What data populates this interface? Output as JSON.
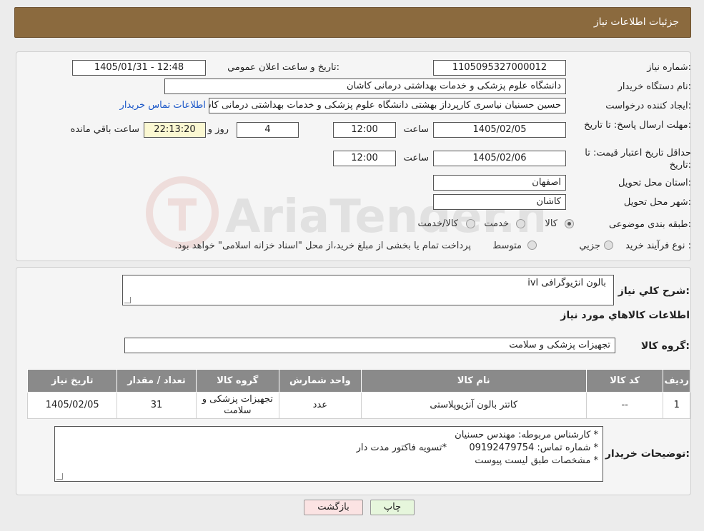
{
  "header": {
    "title": "جزئیات اطلاعات نیاز"
  },
  "form": {
    "need_number_label": "شماره نیاز:",
    "need_number": "1105095327000012",
    "announce_label": "تاریخ و ساعت اعلان عمومي:",
    "announce_value": "1405/01/31 - 12:48",
    "buyer_org_label": "نام دستگاه خریدار:",
    "buyer_org": "دانشگاه علوم پزشکی و خدمات بهداشتی درمانی کاشان",
    "creator_label": "ایجاد کننده درخواست:",
    "creator": "حسین حسنیان نیاسری کارپرداز بهشتی دانشگاه علوم پزشکی و خدمات بهداشتی درمانی کاشان",
    "contact_link": "اطلاعات تماس خریدار",
    "deadline_label": "مهلت ارسال پاسخ: تا تاریخ:",
    "deadline_date": "1405/02/05",
    "time_label": "ساعت",
    "deadline_time": "12:00",
    "days_value": "4",
    "days_label": "روز و",
    "remaining_time": "22:13:20",
    "remaining_label": "ساعت باقي مانده",
    "validity_label": "حداقل تاریخ اعتبار قیمت: تا تاریخ:",
    "validity_date": "1405/02/06",
    "validity_time": "12:00",
    "province_label": "استان محل تحویل:",
    "province": "اصفهان",
    "city_label": "شهر محل تحویل:",
    "city": "کاشان",
    "category_label": "طبقه بندی موضوعی:",
    "category_options": [
      "کالا",
      "خدمت",
      "کالا/خدمت"
    ],
    "process_label": "نوع فرآیند خرید :",
    "process_options": [
      "جزیي",
      "متوسط"
    ],
    "process_note": "پرداخت تمام یا بخشی از مبلغ خرید،از محل \"اسناد خزانه اسلامی\" خواهد بود."
  },
  "description": {
    "label": "شرح كلي نیاز:",
    "value": "بالون انژیوگرافی ivl"
  },
  "goods": {
    "section_title": "اطلاعات كالاهاي مورد نياز",
    "group_label": "گروه کالا:",
    "group_value": "تجهیزات پزشکی و سلامت",
    "columns": [
      "ردیف",
      "کد کالا",
      "نام کالا",
      "واحد شمارش",
      "گروه کالا",
      "تعداد / مقدار",
      "تاریخ نیاز"
    ],
    "rows": [
      [
        "1",
        "--",
        "کاتتر بالون آنژیوپلاستی",
        "عدد",
        "تجهیزات پزشکی و سلامت",
        "31",
        "1405/02/05"
      ]
    ]
  },
  "buyer_notes": {
    "label": "توضیحات خریدار:",
    "line1": "*  کارشناس مربوطه: مهندس حسنیان",
    "line2": "*  شماره تماس: 09192479754",
    "line2_extra": "*تسویه فاکتور مدت دار",
    "line3": "*  مشخصات طبق لیست پیوست"
  },
  "buttons": {
    "print": "چاپ",
    "back": "بازگشت"
  },
  "watermark": {
    "text": "AriaTender.neT"
  },
  "colors": {
    "header_bg": "#8b6a3e",
    "table_header_bg": "#8a8a8a",
    "link": "#1a56c8",
    "back_button_bg": "#fbe3e3",
    "print_button_bg": "#e6f6dc"
  }
}
